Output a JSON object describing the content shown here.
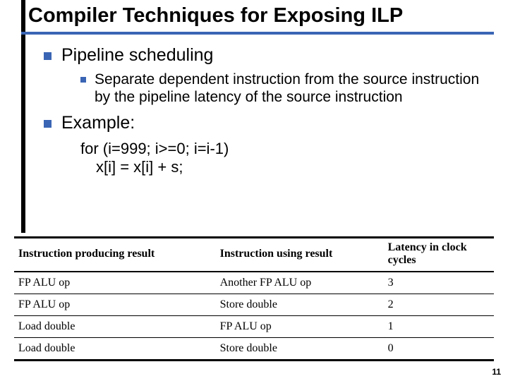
{
  "title": "Compiler Techniques for Exposing ILP",
  "bullets": {
    "l1a": "Pipeline scheduling",
    "l2a": "Separate dependent instruction from the source instruction by the pipeline latency of the source instruction",
    "l1b": "Example:"
  },
  "code": {
    "line1": "for (i=999; i>=0; i=i-1)",
    "line2": "x[i] = x[i] + s;"
  },
  "table": {
    "headers": {
      "producing": "Instruction producing result",
      "using": "Instruction using result",
      "latency": "Latency in clock cycles"
    },
    "rows": [
      {
        "producing": "FP ALU op",
        "using": "Another FP ALU op",
        "latency": "3"
      },
      {
        "producing": "FP ALU op",
        "using": "Store double",
        "latency": "2"
      },
      {
        "producing": "Load double",
        "using": "FP ALU op",
        "latency": "1"
      },
      {
        "producing": "Load double",
        "using": "Store double",
        "latency": "0"
      }
    ]
  },
  "page_number": "11"
}
